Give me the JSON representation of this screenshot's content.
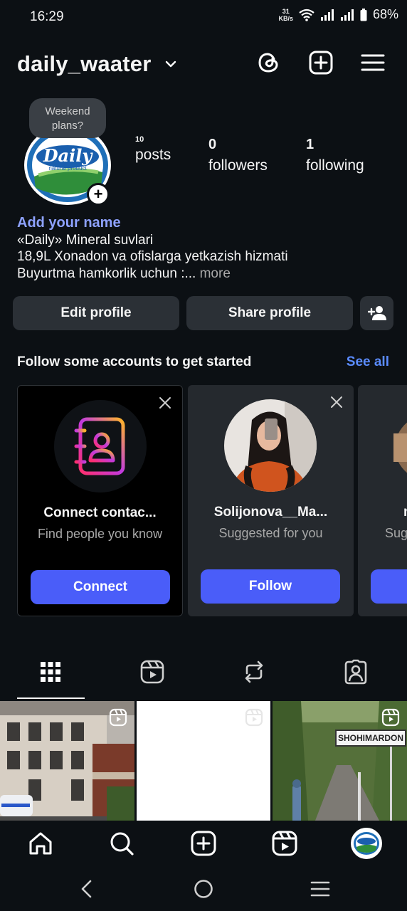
{
  "status_bar": {
    "time": "16:29",
    "net_speed_value": "31",
    "net_speed_unit": "KB/s",
    "battery": "68%"
  },
  "header": {
    "username": "daily_waater",
    "icons": [
      "threads-icon",
      "create-icon",
      "menu-icon"
    ]
  },
  "profile": {
    "note": "Weekend plans?",
    "avatar_logo_text": "Daily",
    "avatar_logo_sub": "natural product",
    "stats": [
      {
        "value": "10",
        "label": "posts"
      },
      {
        "value": "0",
        "label": "followers"
      },
      {
        "value": "1",
        "label": "following"
      }
    ],
    "add_name": "Add your name",
    "bio_lines": [
      "«Daily» Mineral suvlari",
      "18,9L Xonadon va ofislarga yetkazish hizmati",
      "Buyurtma hamkorlik uchun :..."
    ],
    "more": "more"
  },
  "actions": {
    "edit_profile": "Edit profile",
    "share_profile": "Share profile"
  },
  "suggestions": {
    "title": "Follow some accounts to get started",
    "see_all": "See all",
    "cards": [
      {
        "name": "Connect contac...",
        "subtitle": "Find people you know",
        "button": "Connect"
      },
      {
        "name": "Solijonova__Ma...",
        "subtitle": "Suggested for you",
        "button": "Follow"
      },
      {
        "name": "m",
        "subtitle": "Sug",
        "button": ""
      }
    ]
  },
  "grid": {
    "sign_text": "SHOHIMARDON"
  },
  "colors": {
    "background": "#0c1014",
    "button": "#2b3036",
    "accent": "#4a5df9",
    "link": "#5b8cff",
    "add_name": "#8ea2ff"
  }
}
